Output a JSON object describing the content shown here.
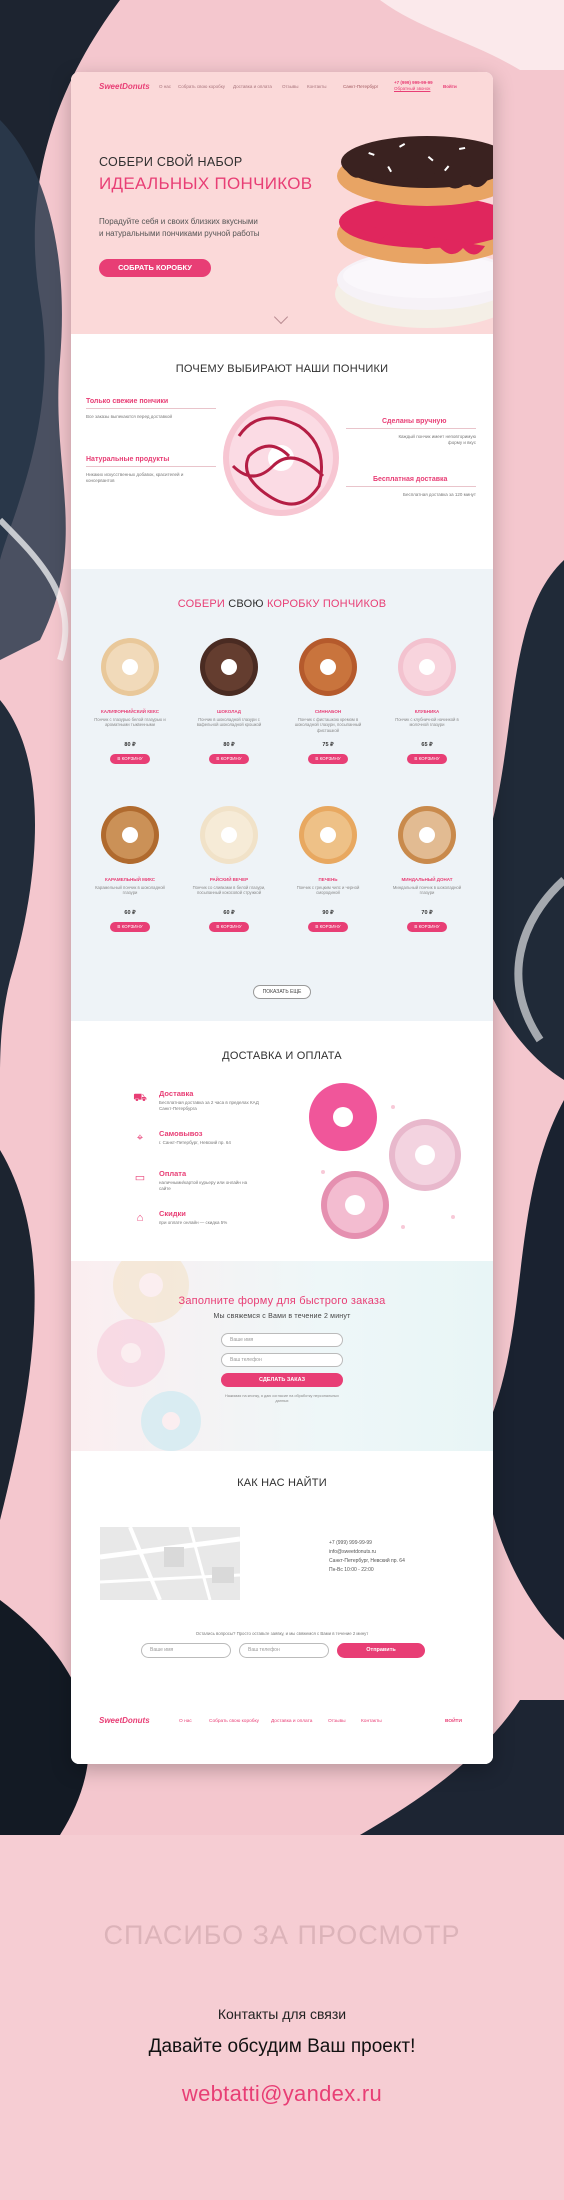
{
  "header": {
    "logo": "SweetDonuts",
    "nav": [
      "О нас",
      "Собрать свою коробку",
      "Доставка и оплата",
      "Отзывы",
      "Контакты"
    ],
    "city": "Санкт-Петербург",
    "phone": "+7 (999) 999-99-99",
    "callback": "Обратный звонок",
    "login": "Войти"
  },
  "hero": {
    "title_line1": "СОБЕРИ СВОЙ НАБОР",
    "title_line2": "ИДЕАЛЬНЫХ ПОНЧИКОВ",
    "lead_line1": "Порадуйте себя и своих близких вкусными",
    "lead_line2": "и натуральными пончиками ручной работы",
    "cta": "СОБРАТЬ КОРОБКУ"
  },
  "why": {
    "title": "ПОЧЕМУ ВЫБИРАЮТ НАШИ ПОНЧИКИ",
    "features": [
      {
        "title": "Только свежие пончики",
        "desc": "Все заказы выпекаются перед доставкой"
      },
      {
        "title": "Натуральные продукты",
        "desc": "Никаких искусственных добавок, красителей и консервантов"
      },
      {
        "title": "Сделаны вручную",
        "desc": "Каждый пончик имеет неповторимую форму и вкус"
      },
      {
        "title": "Бесплатная доставка",
        "desc": "Бесплатная доставка за 120 минут"
      }
    ]
  },
  "catalog": {
    "title_a": "СОБЕРИ",
    "title_b": "СВОЮ",
    "title_c": "КОРОБКУ ПОНЧИКОВ",
    "add_label": "В КОРЗИНУ",
    "more_label": "ПОКАЗАТЬ ЕЩЕ",
    "products": [
      {
        "name": "КАЛИФОРНИЙСКИЙ КЕКС",
        "desc": "Пончик с глазурью белой глазурью и ароматными тыквенными",
        "price": "80 ₽"
      },
      {
        "name": "ШОКОЛАД",
        "desc": "Пончик в шоколадной глазури с вафельной шоколадной крошкой",
        "price": "80 ₽"
      },
      {
        "name": "СИННАБОН",
        "desc": "Пончик с фисташкою кремом в шоколадной глазури, посыпанный фисташкой",
        "price": "75 ₽"
      },
      {
        "name": "КЛУБНИКА",
        "desc": "Пончик с клубничной начинкой в молочной глазури",
        "price": "65 ₽"
      },
      {
        "name": "КАРАМЕЛЬНЫЙ МИКС",
        "desc": "Карамельный пончик в шоколадной глазури",
        "price": "60 ₽"
      },
      {
        "name": "РАЙСКИЙ ВЕЧЕР",
        "desc": "Пончик со сливками в белой глазури, посыпанный кокосовой стружкой",
        "price": "60 ₽"
      },
      {
        "name": "ПЕЧЕНЬ",
        "desc": "Пончик с грецким чипс и черной смородиной",
        "price": "90 ₽"
      },
      {
        "name": "МИНДАЛЬНЫЙ ДОНАТ",
        "desc": "Миндальный пончик в шоколадной глазури",
        "price": "70 ₽"
      }
    ]
  },
  "delivery": {
    "title": "ДОСТАВКА И ОПЛАТА",
    "items": [
      {
        "title": "Доставка",
        "desc": "Бесплатная доставка за 2 часа в пределах КАД Санкт-Петербурга",
        "icon": "truck-icon"
      },
      {
        "title": "Самовывоз",
        "desc": "г. Санкт-Петербург, Невский пр. 64",
        "icon": "location-pin-icon"
      },
      {
        "title": "Оплата",
        "desc": "наличными/картой курьеру или онлайн на сайте",
        "icon": "wallet-icon"
      },
      {
        "title": "Скидки",
        "desc": "при оплате онлайн — скидка 5%",
        "icon": "tag-icon"
      }
    ]
  },
  "quick_order": {
    "title": "Заполните форму для быстрого заказа",
    "subtitle": "Мы свяжемся с Вами в течение 2 минут",
    "name_placeholder": "Ваше имя",
    "phone_placeholder": "Ваш телефон",
    "submit": "СДЕЛАТЬ ЗАКАЗ",
    "note": "Нажимая на кнопку, я даю согласие на обработку персональных данных"
  },
  "find_us": {
    "title": "КАК НАС НАЙТИ",
    "phone": "+7 (999) 999-99-99",
    "email": "info@sweetdonuts.ru",
    "address": "Санкт-Петербург, Невский пр. 64",
    "hours": "Пн-Вс 10:00 - 22:00",
    "question": "Остались вопросы? Просто оставьте заявку, и мы свяжемся с Вами в течение 2 минут",
    "name_placeholder": "Ваше имя",
    "phone_placeholder": "Ваш телефон",
    "submit": "Отправить"
  },
  "footer": {
    "logo": "SweetDonuts",
    "nav": [
      "О нас",
      "Собрать свою коробку",
      "Доставка и оплата",
      "Отзывы",
      "Контакты"
    ],
    "login": "ВОЙТИ"
  },
  "outro": {
    "thanks": "СПАСИБО ЗА ПРОСМОТР",
    "contacts_label": "Контакты для связи",
    "cta": "Давайте обсудим Ваш проект!",
    "email": "webtatti@yandex.ru"
  },
  "colors": {
    "accent": "#e83e75",
    "background": "#f6cdd3",
    "hero": "#fbd9d9",
    "catalog_bg": "#eef3f7"
  }
}
